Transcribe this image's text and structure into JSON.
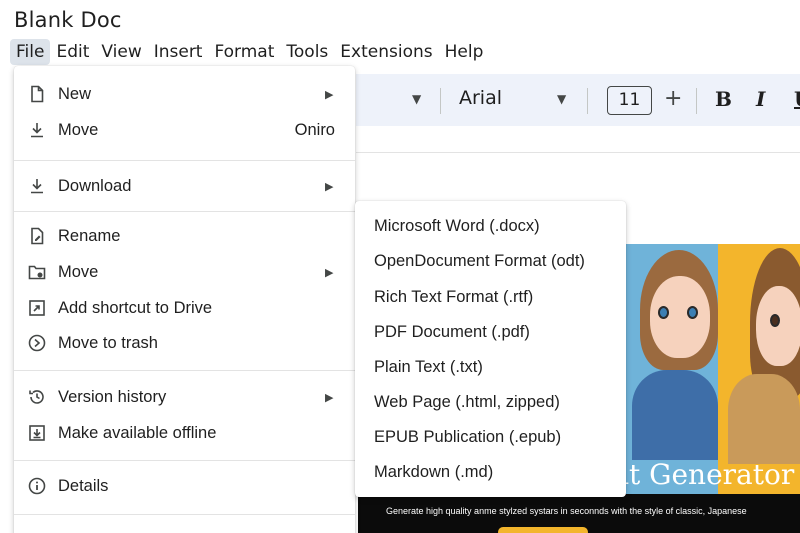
{
  "app": {
    "title": "Blank Doc"
  },
  "menubar": {
    "items": [
      "File",
      "Edit",
      "View",
      "Insert",
      "Format",
      "Tools",
      "Extensions",
      "Help"
    ],
    "active": "File"
  },
  "toolbar": {
    "font_name": "Arial",
    "font_size": "11",
    "increase_label": "+",
    "bold_label": "B",
    "italic_label": "I",
    "underline_label": "U"
  },
  "file_menu": {
    "items": [
      {
        "label": "New",
        "icon": "new-document-icon",
        "submenu": true
      },
      {
        "label": "Move",
        "icon": "download-arrow-icon",
        "shortcut": "Oniro"
      },
      {
        "label": "Download",
        "icon": "download-icon",
        "submenu": true
      },
      {
        "label": "Rename",
        "icon": "rename-icon"
      },
      {
        "label": "Move",
        "icon": "move-folder-icon",
        "submenu": true
      },
      {
        "label": "Add shortcut to Drive",
        "icon": "add-shortcut-icon"
      },
      {
        "label": "Move to trash",
        "icon": "trash-icon"
      },
      {
        "label": "Version history",
        "icon": "history-icon",
        "submenu": true
      },
      {
        "label": "Make available offline",
        "icon": "offline-icon"
      },
      {
        "label": "Details",
        "icon": "info-icon"
      }
    ]
  },
  "download_submenu": {
    "items": [
      "Microsoft Word (.docx)",
      "OpenDocument Format (odt)",
      "Rich Text Format (.rtf)",
      "PDF Document (.pdf)",
      "Plain Text (.txt)",
      "Web Page (.html, zipped)",
      "EPUB Publication (.epub)",
      "Markdown (.md)"
    ]
  },
  "document": {
    "banner_title": "it Generator",
    "banner_subtitle": "Generate high quality anme stylzed systars in seconnds with the style of classic, Japanese"
  },
  "colors": {
    "accent_active_menu": "#dde3ea",
    "toolbar_bg": "#eef2fa",
    "banner_blue": "#6fb3d9",
    "banner_yellow": "#f3b52c"
  }
}
